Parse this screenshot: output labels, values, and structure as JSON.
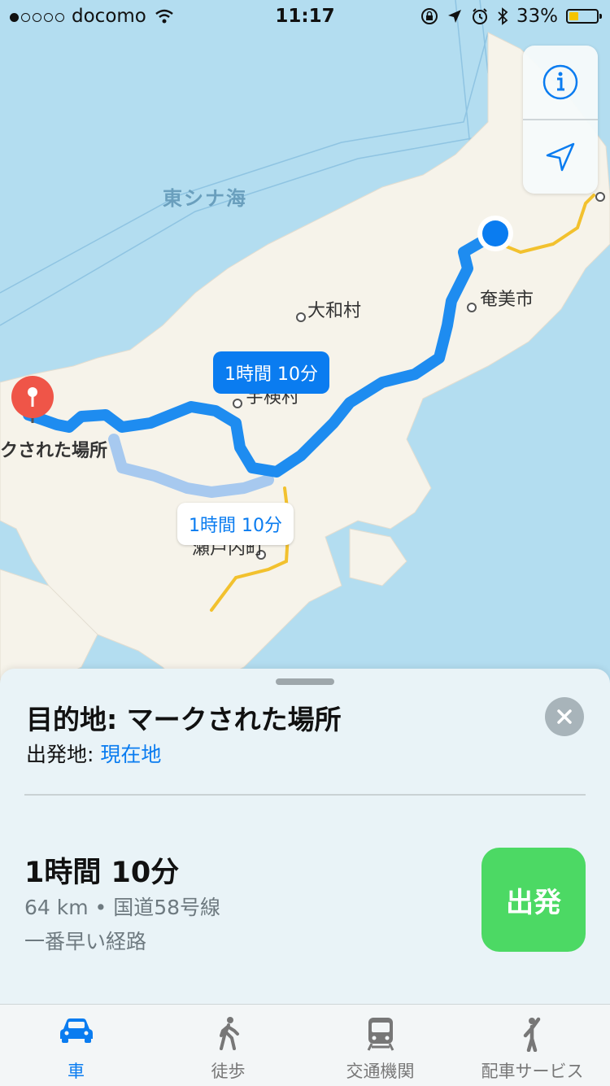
{
  "status_bar": {
    "carrier": "docomo",
    "time": "11:17",
    "battery_percent": "33%",
    "battery_level": 0.33,
    "signal_bars_filled": 1,
    "signal_bars_total": 5
  },
  "map": {
    "sea_label": "東シナ海",
    "places": {
      "city": "奄美市",
      "village_1": "大和村",
      "village_2": "宇検村",
      "town": "瀬戸内町",
      "marker": "クされた場所"
    },
    "route_callouts": {
      "primary": "1時間 10分",
      "alternate": "1時間 10分"
    },
    "colors": {
      "water": "#b3ddf0",
      "land": "#f6f3ea",
      "route": "#1e8cf0",
      "route_alt": "#a7c9ef",
      "road": "#f2c12e",
      "pin": "#ef5548",
      "location": "#0a7cf0"
    }
  },
  "controls": {
    "info_icon": "info-icon",
    "location_icon": "location-arrow-icon"
  },
  "sheet": {
    "destination_title": "目的地: マークされた場所",
    "origin_label": "出発地:",
    "origin_value": "現在地",
    "duration": "1時間 10分",
    "route_info": "64 km • 国道58号線",
    "route_note": "一番早い経路",
    "go_label": "出発"
  },
  "tabs": [
    {
      "label": "車",
      "icon": "car-icon",
      "active": true
    },
    {
      "label": "徒歩",
      "icon": "walking-icon",
      "active": false
    },
    {
      "label": "交通機関",
      "icon": "train-icon",
      "active": false
    },
    {
      "label": "配車サービス",
      "icon": "ride-hail-icon",
      "active": false
    }
  ]
}
